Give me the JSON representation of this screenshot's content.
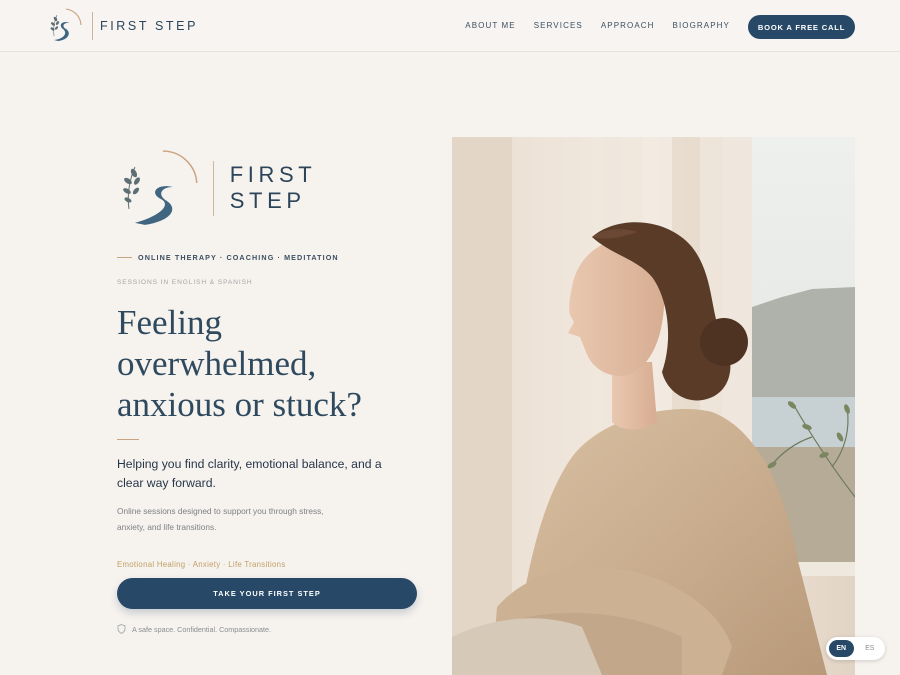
{
  "header": {
    "brand_name": "FIRST STEP",
    "nav": [
      "ABOUT ME",
      "SERVICES",
      "APPROACH",
      "BIOGRAPHY"
    ],
    "cta_label": "BOOK A FREE CALL"
  },
  "hero": {
    "logo_name": "FIRST STEP",
    "eyebrow": "ONLINE THERAPY · COACHING · MEDITATION",
    "languages_note": "SESSIONS IN ENGLISH & SPANISH",
    "headline": [
      "Feeling",
      "overwhelmed,",
      "anxious or stuck?"
    ],
    "subheadline": "Helping you find clarity, emotional balance, and a clear way forward.",
    "body": "Online sessions designed to support you through stress, anxiety, and life transitions.",
    "tags": "Emotional Healing · Anxiety · Life Transitions",
    "cta_label": "TAKE YOUR FIRST STEP",
    "reassurance": "A safe space. Confidential. Compassionate."
  },
  "language_toggle": {
    "options": [
      "EN",
      "ES"
    ],
    "selected": "EN"
  },
  "colors": {
    "background": "#f6f2ee",
    "navy": "#274866",
    "accent_tan": "#c9a27f",
    "tag_gold": "#c2a067"
  }
}
